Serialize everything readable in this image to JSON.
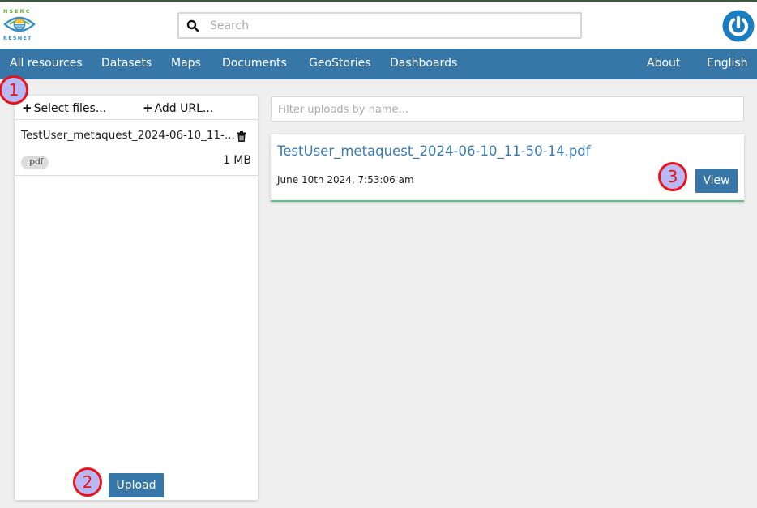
{
  "header": {
    "logo": {
      "top_text": "NSERC",
      "bottom_text": "RESNET"
    },
    "search": {
      "placeholder": "Search",
      "value": ""
    },
    "power_icon": "power-icon"
  },
  "navbar": {
    "left_items": [
      {
        "label": "All resources"
      },
      {
        "label": "Datasets"
      },
      {
        "label": "Maps"
      },
      {
        "label": "Documents"
      },
      {
        "label": "GeoStories"
      },
      {
        "label": "Dashboards"
      }
    ],
    "right_items": [
      {
        "label": "About"
      },
      {
        "label": "English"
      }
    ]
  },
  "markers": [
    "1",
    "2",
    "3"
  ],
  "upload_panel": {
    "select_files_label": "Select files...",
    "add_url_label": "Add URL...",
    "files": [
      {
        "name": "TestUser_metaquest_2024-06-10_11-...",
        "extension": ".pdf",
        "size": "1 MB"
      }
    ],
    "upload_label": "Upload"
  },
  "uploads_list": {
    "filter_placeholder": "Filter uploads by name...",
    "items": [
      {
        "name": "TestUser_metaquest_2024-06-10_11-50-14.pdf",
        "date": "June 10th 2024, 7:53:06 am",
        "action_label": "View",
        "status_color": "#5cc27e"
      }
    ]
  },
  "colors": {
    "primary": "#3777a8",
    "link": "#3a7bb0",
    "success": "#5cc27e",
    "marker_border": "#e8131b",
    "marker_fill": "#b8b8f4"
  }
}
